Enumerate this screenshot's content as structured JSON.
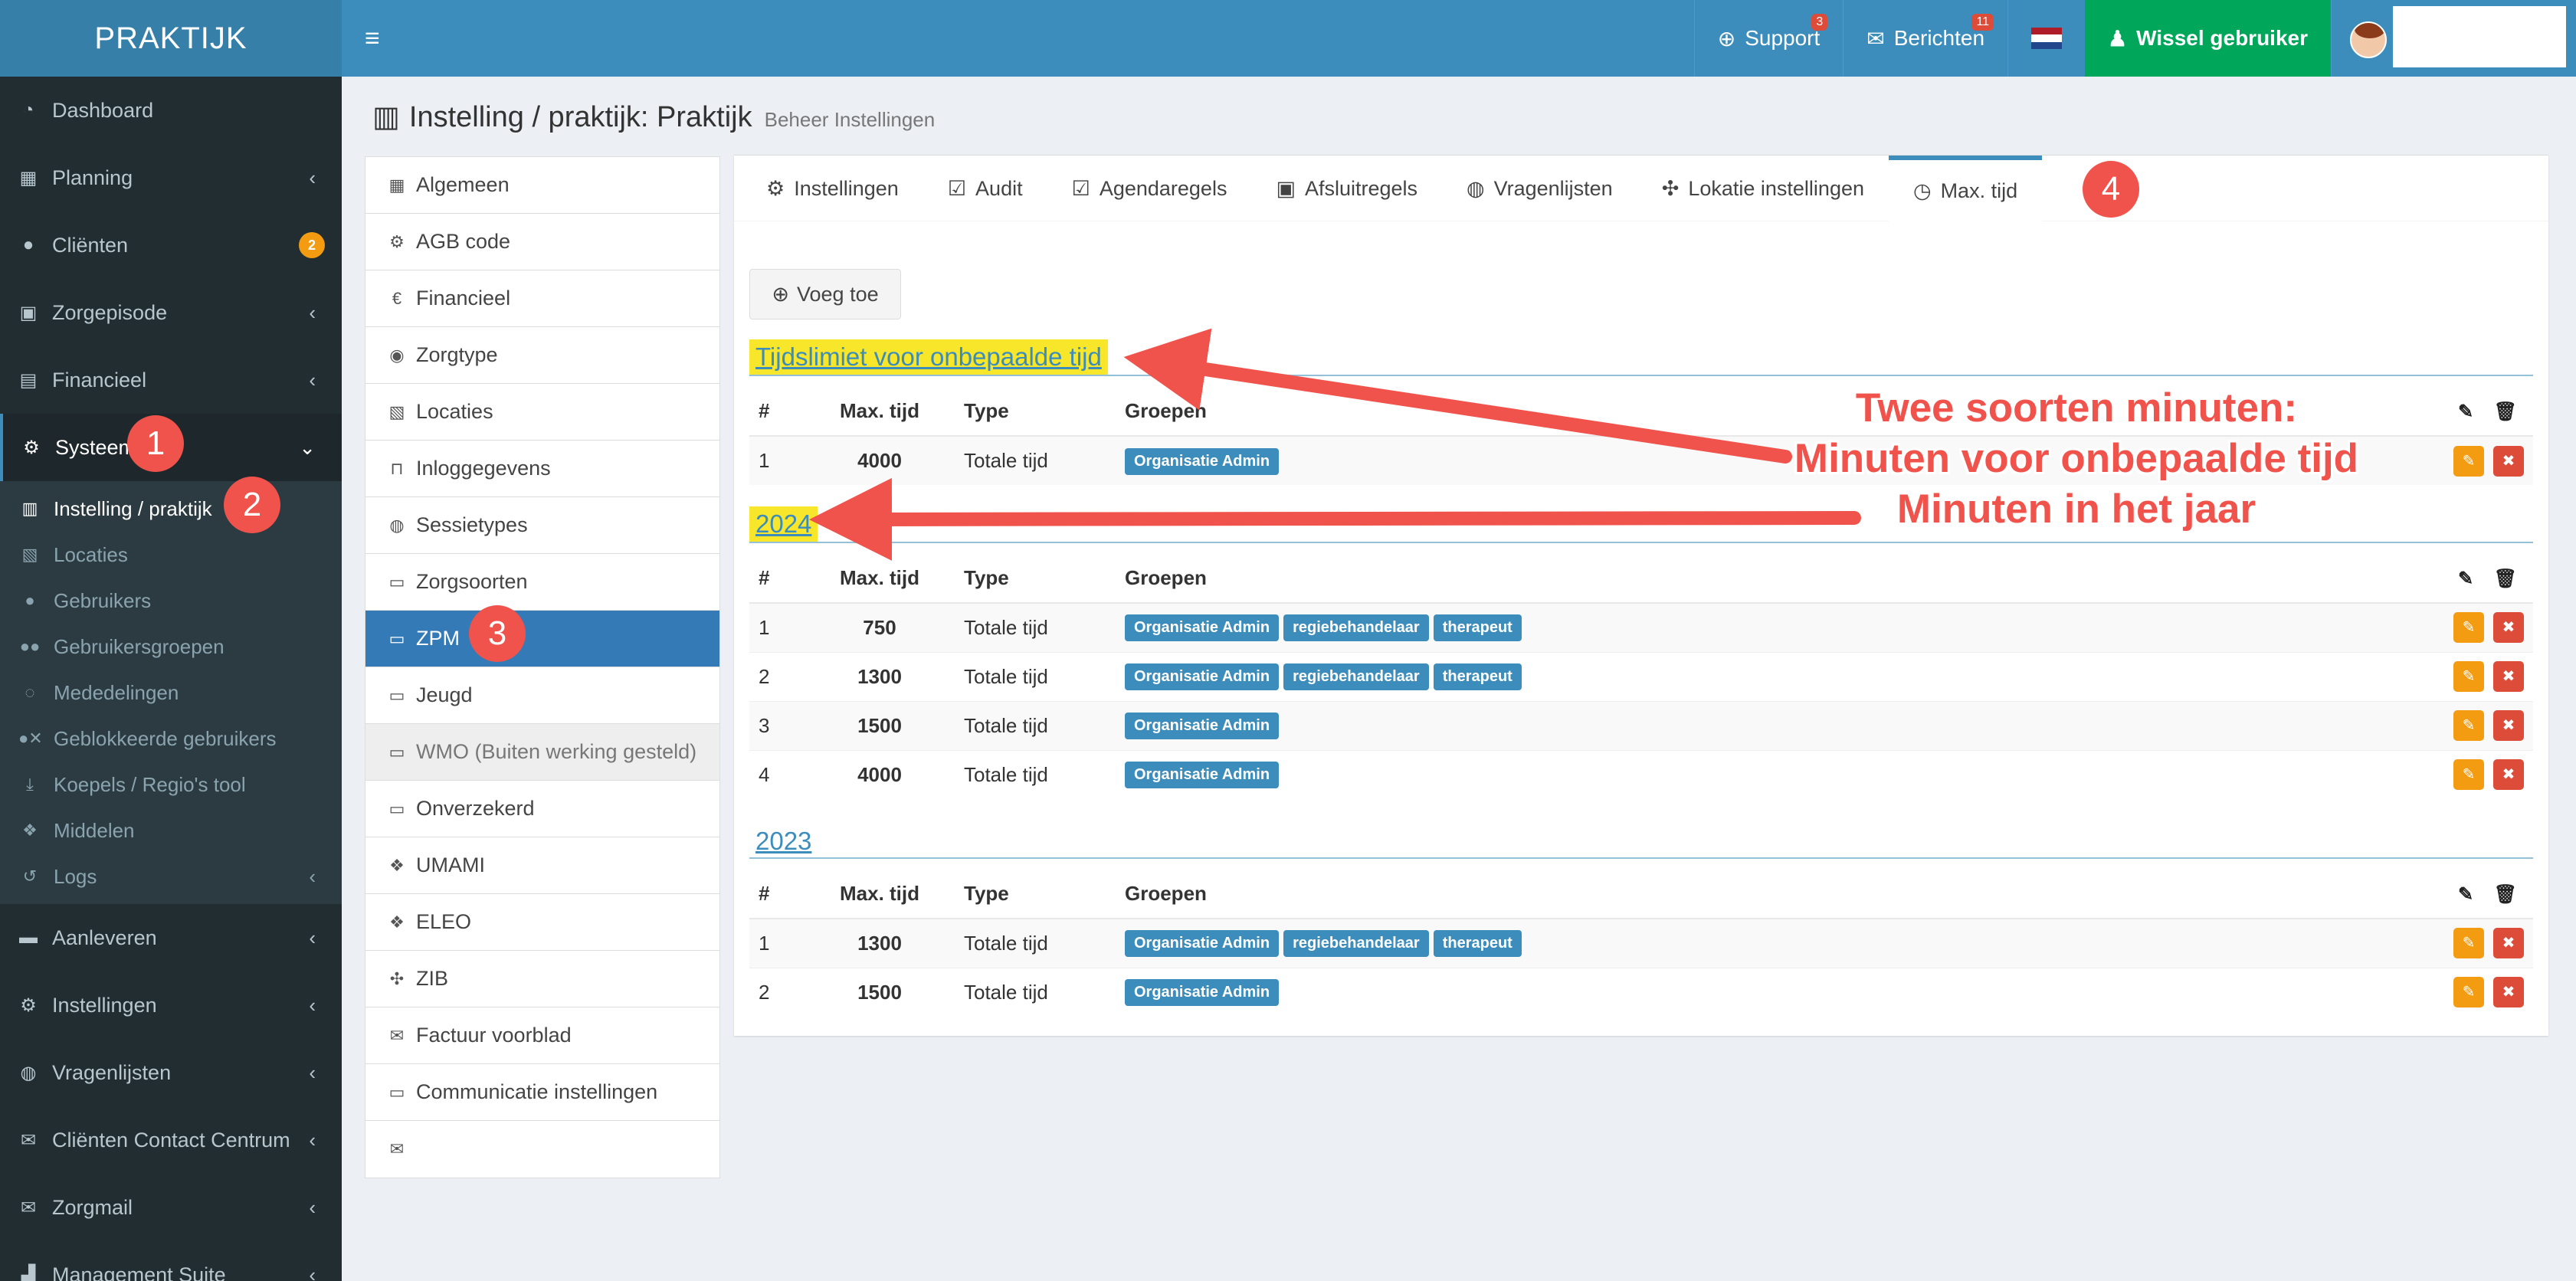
{
  "brand": "PRAKTIJK",
  "topnav": {
    "support_label": "Support",
    "support_badge": "3",
    "messages_label": "Berichten",
    "messages_badge": "11",
    "switch_user_label": "Wissel gebruiker",
    "flag_colors": [
      "#ae1c28",
      "#ffffff",
      "#21468b"
    ]
  },
  "sidebar": {
    "items": [
      {
        "label": "Dashboard",
        "icon": "dashboard-icon"
      },
      {
        "label": "Planning",
        "icon": "calendar-icon"
      },
      {
        "label": "Cliënten",
        "icon": "user-icon",
        "badge": "2"
      },
      {
        "label": "Zorgepisode",
        "icon": "episode-icon"
      },
      {
        "label": "Financieel",
        "icon": "book-icon"
      },
      {
        "label": "Systeem",
        "icon": "cogs-icon"
      }
    ],
    "systeem_sub": [
      {
        "label": "Instelling / praktijk",
        "icon": "hospital-icon"
      },
      {
        "label": "Locaties",
        "icon": "map-icon"
      },
      {
        "label": "Gebruikers",
        "icon": "user-icon"
      },
      {
        "label": "Gebruikersgroepen",
        "icon": "users-icon"
      },
      {
        "label": "Mededelingen",
        "icon": "comments-icon"
      },
      {
        "label": "Geblokkeerde gebruikers",
        "icon": "user-times-icon"
      },
      {
        "label": "Koepels / Regio's tool",
        "icon": "download-icon"
      },
      {
        "label": "Middelen",
        "icon": "cubes-icon"
      },
      {
        "label": "Logs",
        "icon": "history-icon"
      }
    ],
    "bottom_items": [
      {
        "label": "Aanleveren",
        "icon": "truck-icon"
      },
      {
        "label": "Instellingen",
        "icon": "gear-icon"
      },
      {
        "label": "Vragenlijsten",
        "icon": "globe-icon"
      },
      {
        "label": "Cliënten Contact Centrum",
        "icon": "envelope-icon"
      },
      {
        "label": "Zorgmail",
        "icon": "envelope-icon"
      },
      {
        "label": "Management Suite",
        "icon": "chart-icon"
      }
    ]
  },
  "page": {
    "title": "Instelling / praktijk: Praktijk",
    "subtitle": "Beheer Instellingen"
  },
  "settings_list": [
    {
      "label": "Algemeen",
      "icon": "table-icon"
    },
    {
      "label": "AGB code",
      "icon": "cogs-icon"
    },
    {
      "label": "Financieel",
      "icon": "euro-icon"
    },
    {
      "label": "Zorgtype",
      "icon": "accessibility-icon"
    },
    {
      "label": "Locaties",
      "icon": "map-icon"
    },
    {
      "label": "Inloggegevens",
      "icon": "unlock-icon"
    },
    {
      "label": "Sessietypes",
      "icon": "globe-icon"
    },
    {
      "label": "Zorgsoorten",
      "icon": "briefcase-icon"
    },
    {
      "label": "ZPM",
      "icon": "briefcase-icon"
    },
    {
      "label": "Jeugd",
      "icon": "briefcase-icon"
    },
    {
      "label": "WMO (Buiten werking gesteld)",
      "icon": "briefcase-icon"
    },
    {
      "label": "Onverzekerd",
      "icon": "briefcase-icon"
    },
    {
      "label": "UMAMI",
      "icon": "cubes-icon"
    },
    {
      "label": "ELEO",
      "icon": "cubes-icon"
    },
    {
      "label": "ZIB",
      "icon": "puzzle-icon"
    },
    {
      "label": "Factuur voorblad",
      "icon": "envelope-icon"
    },
    {
      "label": "Communicatie instellingen",
      "icon": "briefcase-icon"
    },
    {
      "label": "",
      "icon": "envelope-icon"
    }
  ],
  "tabs": [
    {
      "label": "Instellingen",
      "icon": "gear-icon"
    },
    {
      "label": "Audit",
      "icon": "check-square-icon"
    },
    {
      "label": "Agendaregels",
      "icon": "check-square-icon"
    },
    {
      "label": "Afsluitregels",
      "icon": "medkit-icon"
    },
    {
      "label": "Vragenlijsten",
      "icon": "globe-icon"
    },
    {
      "label": "Lokatie instellingen",
      "icon": "puzzle-icon"
    },
    {
      "label": "Max. tijd",
      "icon": "clock-icon"
    }
  ],
  "add_button": "Voeg toe",
  "columns": [
    "#",
    "Max. tijd",
    "Type",
    "Groepen"
  ],
  "sections": [
    {
      "title": "Tijdslimiet voor onbepaalde tijd",
      "rows": [
        {
          "n": "1",
          "max": "4000",
          "type": "Totale tijd",
          "groups": [
            "Organisatie Admin"
          ]
        }
      ]
    },
    {
      "title": "2024",
      "rows": [
        {
          "n": "1",
          "max": "750",
          "type": "Totale tijd",
          "groups": [
            "Organisatie Admin",
            "regiebehandelaar",
            "therapeut"
          ]
        },
        {
          "n": "2",
          "max": "1300",
          "type": "Totale tijd",
          "groups": [
            "Organisatie Admin",
            "regiebehandelaar",
            "therapeut"
          ]
        },
        {
          "n": "3",
          "max": "1500",
          "type": "Totale tijd",
          "groups": [
            "Organisatie Admin"
          ]
        },
        {
          "n": "4",
          "max": "4000",
          "type": "Totale tijd",
          "groups": [
            "Organisatie Admin"
          ]
        }
      ]
    },
    {
      "title": "2023",
      "rows": [
        {
          "n": "1",
          "max": "1300",
          "type": "Totale tijd",
          "groups": [
            "Organisatie Admin",
            "regiebehandelaar",
            "therapeut"
          ]
        },
        {
          "n": "2",
          "max": "1500",
          "type": "Totale tijd",
          "groups": [
            "Organisatie Admin"
          ]
        }
      ]
    }
  ],
  "annotations": {
    "markers": [
      "1",
      "2",
      "3",
      "4"
    ],
    "callout_lines": [
      "Twee soorten minuten:",
      "Minuten voor onbepaalde tijd",
      "Minuten in het jaar"
    ]
  }
}
